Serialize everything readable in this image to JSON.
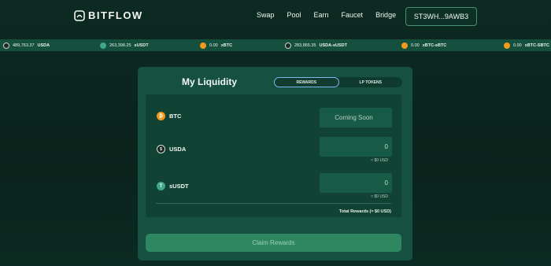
{
  "brand": {
    "name": "BITFLOW"
  },
  "nav": {
    "items": [
      "Swap",
      "Pool",
      "Earn",
      "Faucet",
      "Bridge"
    ],
    "wallet": "ST3WH...9AWB3"
  },
  "ticker": [
    {
      "icon": "usda-icon",
      "amount": "489,763.37",
      "symbol": "USDA"
    },
    {
      "icon": "usdt-icon",
      "amount": "263,398.25",
      "symbol": "sUSDT"
    },
    {
      "icon": "btc-icon",
      "amount": "0.00",
      "symbol": "xBTC"
    },
    {
      "icon": "usda-icon",
      "amount": "283,865.35",
      "symbol": "USDA-sUSDT"
    },
    {
      "icon": "btc-icon",
      "amount": "0.00",
      "symbol": "xBTC-sBTC"
    },
    {
      "icon": "btc-icon",
      "amount": "0.00",
      "symbol": "xBTC-SBTC"
    }
  ],
  "card": {
    "title": "My Liquidity",
    "tabs": {
      "rewards": "REWARDS",
      "lp_tokens": "LP TOKENS",
      "active": "rewards"
    },
    "rows": [
      {
        "symbol": "BTC",
        "value": "Coming Soon",
        "usd": ""
      },
      {
        "symbol": "USDA",
        "value": "0",
        "usd": "≈ $0 USD"
      },
      {
        "symbol": "sUSDT",
        "value": "0",
        "usd": "≈ $0 USD"
      }
    ],
    "total": "Total Rewards (≈ $0 USD)",
    "claim_label": "Claim Rewards"
  },
  "colors": {
    "accent": "#2d8862",
    "card": "#155040",
    "background": "#0c2a22"
  }
}
